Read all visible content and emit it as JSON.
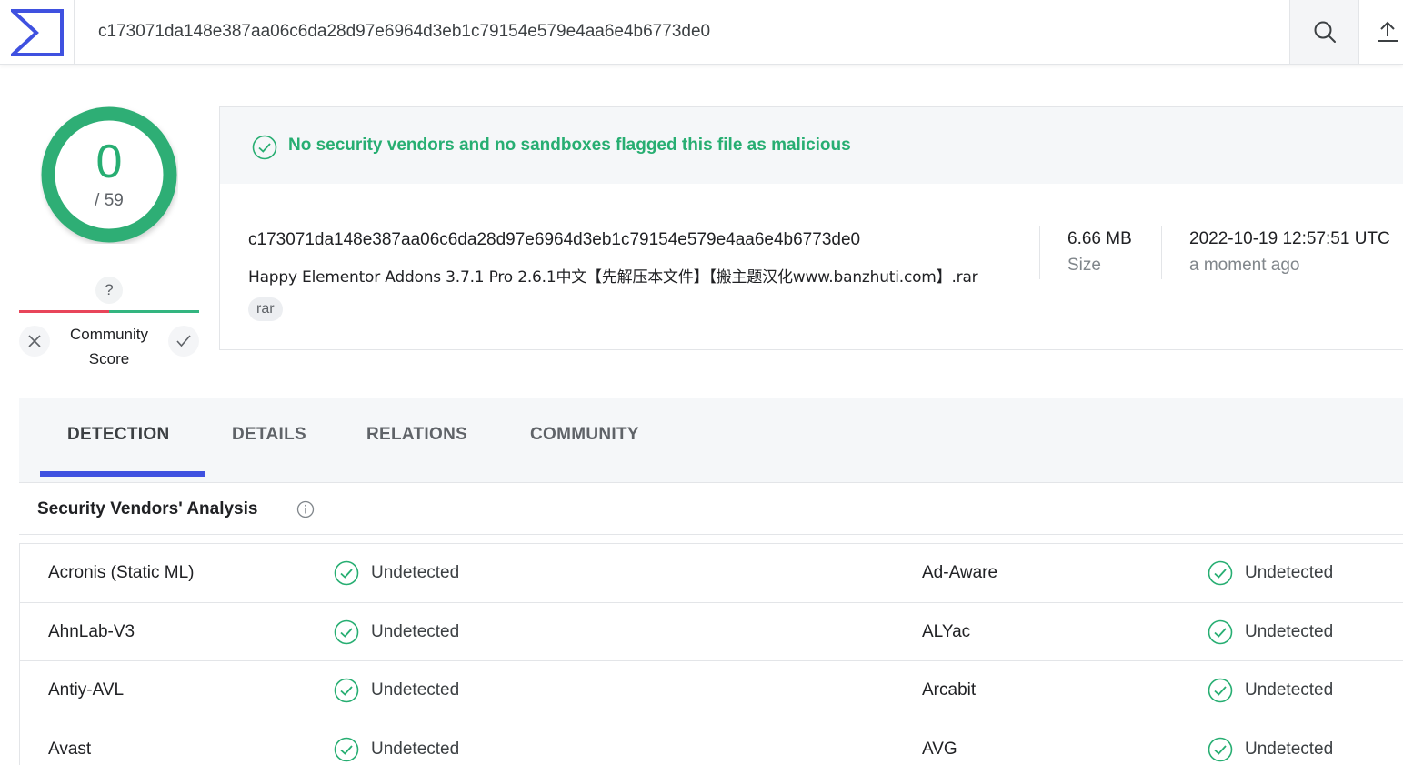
{
  "search": {
    "value": "c173071da148e387aa06c6da28d97e6964d3eb1c79154e579e4aa6e4b6773de0"
  },
  "score": {
    "detections": "0",
    "total": "/ 59"
  },
  "community": {
    "badge": "?",
    "label_line1": "Community",
    "label_line2": "Score"
  },
  "summary": {
    "verdict": "No security vendors and no sandboxes flagged this file as malicious",
    "hash": "c173071da148e387aa06c6da28d97e6964d3eb1c79154e579e4aa6e4b6773de0",
    "file_name": "Happy Elementor Addons 3.7.1 Pro 2.6.1中文【先解压本文件】【搬主题汉化www.banzhuti.com】.rar",
    "tag": "rar",
    "size_value": "6.66 MB",
    "size_label": "Size",
    "date_value": "2022-10-19 12:57:51 UTC",
    "date_relative": "a moment ago"
  },
  "tabs": [
    {
      "label": "DETECTION",
      "active": true
    },
    {
      "label": "DETAILS",
      "active": false
    },
    {
      "label": "RELATIONS",
      "active": false
    },
    {
      "label": "COMMUNITY",
      "active": false
    }
  ],
  "analysis": {
    "title": "Security Vendors' Analysis",
    "rows": [
      {
        "left_vendor": "Acronis (Static ML)",
        "left_result": "Undetected",
        "right_vendor": "Ad-Aware",
        "right_result": "Undetected"
      },
      {
        "left_vendor": "AhnLab-V3",
        "left_result": "Undetected",
        "right_vendor": "ALYac",
        "right_result": "Undetected"
      },
      {
        "left_vendor": "Antiy-AVL",
        "left_result": "Undetected",
        "right_vendor": "Arcabit",
        "right_result": "Undetected"
      },
      {
        "left_vendor": "Avast",
        "left_result": "Undetected",
        "right_vendor": "AVG",
        "right_result": "Undetected"
      }
    ]
  },
  "colors": {
    "clean": "#27ae72",
    "accent": "#3f51e0",
    "malicious": "#e8455a"
  }
}
